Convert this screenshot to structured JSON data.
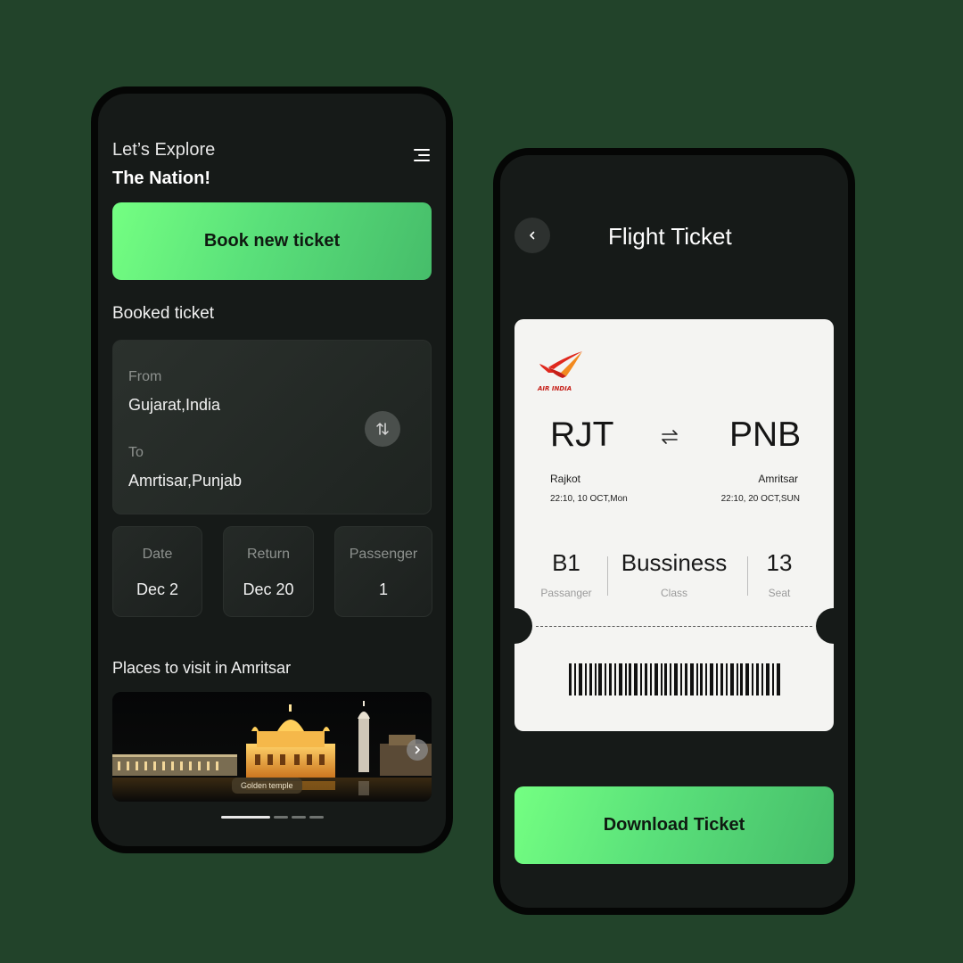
{
  "left": {
    "greeting_line1": "Let’s Explore",
    "greeting_line2": "The Nation!",
    "book_button": "Book new ticket",
    "booked_title": "Booked ticket",
    "from_label": "From",
    "from_value": "Gujarat,India",
    "to_label": "To",
    "to_value": "Amrtisar,Punjab",
    "date_label": "Date",
    "date_value": "Dec 2",
    "return_label": "Return",
    "return_value": "Dec 20",
    "passenger_label": "Passenger",
    "passenger_value": "1",
    "places_title": "Places to visit in Amritsar",
    "place_caption": "Golden temple",
    "carousel_pages": 4,
    "carousel_active": 1
  },
  "right": {
    "title": "Flight Ticket",
    "airline_logo_text": "AIR INDIA",
    "from_code": "RJT",
    "to_code": "PNB",
    "from_city": "Rajkot",
    "to_city": "Amritsar",
    "from_datetime": "22:10, 10 OCT,Mon",
    "to_datetime": "22:10, 20 OCT,SUN",
    "passenger_value": "B1",
    "passenger_label": "Passanger",
    "class_value": "Bussiness",
    "class_label": "Class",
    "seat_value": "13",
    "seat_label": "Seat",
    "download_button": "Download Ticket"
  },
  "icons": [
    "menu-icon",
    "swap-vertical-icon",
    "chevron-right-icon",
    "chevron-left-icon",
    "swap-horizontal-icon",
    "air-india-logo",
    "barcode"
  ],
  "colors": {
    "background": "#22432a",
    "phone": "#161a18",
    "accent_start": "#74ff82",
    "accent_end": "#46bd6a",
    "ticket": "#f4f4f2"
  }
}
